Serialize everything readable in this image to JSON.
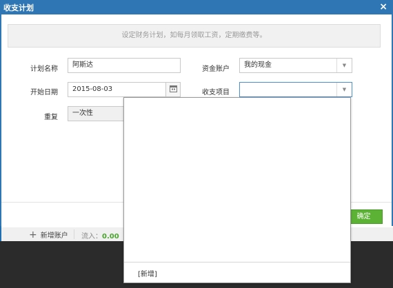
{
  "dialog": {
    "title": "收支计划",
    "close_label": "×",
    "notice": "设定财务计划，如每月领取工资，定期缴费等。",
    "fields": {
      "plan_name": {
        "label": "计划名称",
        "value": "阿斯达"
      },
      "start_date": {
        "label": "开始日期",
        "value": "2015-08-03"
      },
      "repeat": {
        "label": "重复",
        "value": "一次性"
      },
      "account": {
        "label": "资金账户",
        "value": "我的现金"
      },
      "category": {
        "label": "收支项目",
        "value": ""
      }
    },
    "ok_label": "确定"
  },
  "dropdown": {
    "new_label": "[新增]"
  },
  "background": {
    "add_account_label": "新增账户",
    "inflow_label": "流入：",
    "inflow_value": "0.00"
  },
  "colors": {
    "title_bar": "#2f76b5",
    "ok_button": "#5cb234",
    "inflow_value": "#4aa52e"
  },
  "icons": {
    "calendar": "calendar-icon",
    "dropdown_arrow": "chevron-down-icon",
    "close": "close-icon",
    "plus": "plus-icon"
  }
}
